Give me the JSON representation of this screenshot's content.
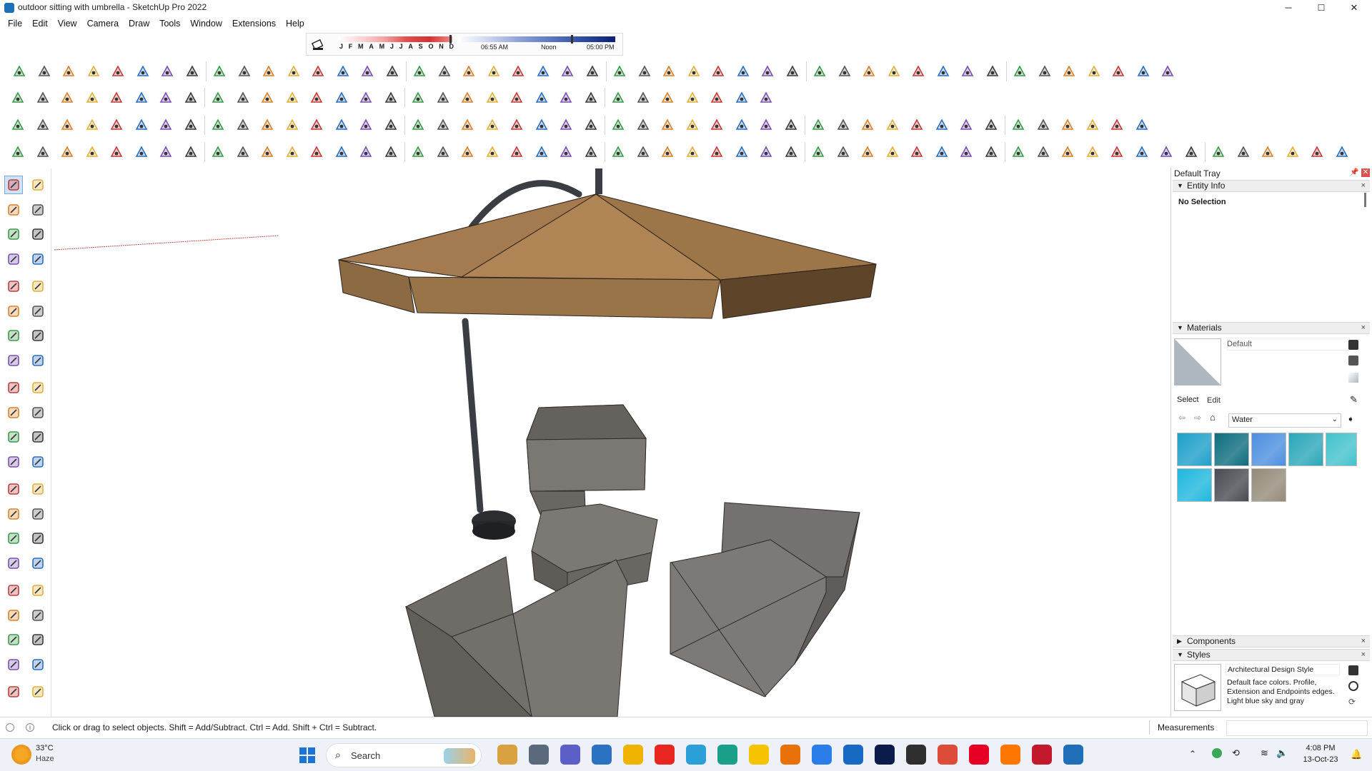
{
  "window": {
    "title": "outdoor sitting with umbrella - SketchUp Pro 2022",
    "controls": {
      "minimize": "─",
      "maximize": "☐",
      "close": "✕"
    }
  },
  "menubar": {
    "items": [
      "File",
      "Edit",
      "View",
      "Camera",
      "Draw",
      "Tools",
      "Window",
      "Extensions",
      "Help"
    ]
  },
  "shadows": {
    "months": [
      "J",
      "F",
      "M",
      "A",
      "M",
      "J",
      "J",
      "A",
      "S",
      "O",
      "N",
      "D"
    ],
    "time_start": "06:55 AM",
    "time_mid": "Noon",
    "time_end": "05:00 PM"
  },
  "toolbars": {
    "row1_icons": [
      "curve-tool-icon",
      "bezier-icon",
      "spline-icon",
      "tangent-icon",
      "polygon-icon",
      "arc-icon",
      "extrude-icon",
      "pipe-icon",
      "loft-icon",
      "sweep-icon",
      "offset-icon",
      "fillet-icon",
      "chamfer-icon",
      "weld-icon",
      "divide-icon",
      "stair-icon",
      "rail-icon",
      "wall-icon",
      "roof-icon",
      "truss-icon",
      "frame-icon",
      "joist-icon",
      "rafter-icon",
      "beam-icon",
      "column-icon",
      "slab-icon",
      "door-icon",
      "window-icon",
      "cabinet-icon",
      "fence-icon",
      "deck-icon",
      "shingle-icon",
      "siding-icon",
      "brick-icon",
      "tile-icon",
      "panel-icon",
      "grid-icon",
      "mesh-icon",
      "loop-icon",
      "ribbon-icon",
      "bridge-icon",
      "knot-icon",
      "sphere-icon",
      "house-icon",
      "house-outline-icon",
      "shed-icon",
      "garage-icon"
    ],
    "row2_icons": [
      "zoom-extents-icon",
      "select-icon",
      "eraser-icon",
      "pencil-icon",
      "arc-draw-icon",
      "rectangle-icon",
      "push-pull-icon",
      "follow-me-icon",
      "move-icon",
      "rotate-icon",
      "scale-icon",
      "tape-icon",
      "text-icon",
      "paint-icon",
      "orbit-icon",
      "pan-icon",
      "zoom-icon",
      "zoom-window-icon",
      "warehouse-icon",
      "extension-icon",
      "layers-icon",
      "outliner-icon",
      "styles-icon",
      "sandbox-icon",
      "import-icon",
      "export-red-icon",
      "export-blue-icon",
      "export-green-icon",
      "export-orange-icon",
      "export-pink-icon",
      "plugin-icon"
    ],
    "row3_icons": [
      "camera-icon",
      "box-icon",
      "iso-icon",
      "front-icon",
      "back-icon",
      "left-icon",
      "right-icon",
      "top-icon",
      "bottom-icon",
      "section-icon",
      "xray-icon",
      "wire-icon",
      "hidden-icon",
      "shaded-icon",
      "texture-icon",
      "mono-icon",
      "shadow-icon",
      "fog-icon",
      "edge-icon",
      "profile-icon",
      "ground-icon",
      "sky-icon",
      "scene-icon",
      "animation-icon",
      "walk-icon",
      "look-icon",
      "position-icon",
      "camera2-icon",
      "sun-icon",
      "grid2-icon",
      "axis-icon",
      "layout-icon",
      "solid-icon",
      "intersect-icon",
      "union-icon",
      "subtract-icon",
      "trim-icon",
      "split-icon",
      "shell-icon",
      "component-icon",
      "group-icon",
      "explode-icon",
      "lock-icon",
      "unlock-icon",
      "hide-icon",
      "unhide-icon"
    ],
    "row4_icons": [
      "smooth-icon",
      "sun-shade-icon",
      "circle-icon",
      "angle-icon",
      "flag-icon",
      "star-icon",
      "dome-icon",
      "ball-icon",
      "copy-icon",
      "paste-icon",
      "cut-icon",
      "duplicate-icon",
      "array-icon",
      "mirror-icon",
      "align-icon",
      "hand-icon",
      "plane-icon",
      "diamond-icon",
      "yellow-diamond-icon",
      "green-diamond-icon",
      "red-diamond-icon",
      "flat-icon",
      "turn-icon",
      "red-block-icon",
      "stack-icon",
      "page-icon",
      "brown-box-icon",
      "link-icon",
      "corner-icon",
      "nodes-icon",
      "plus-red-icon",
      "plus-green-icon",
      "cross-blue-icon",
      "cone-icon",
      "cone2-icon",
      "cone3-icon",
      "lasso-icon",
      "lasso2-icon",
      "rope-icon",
      "arrows-icon",
      "cup-icon",
      "magnet-icon",
      "green-tree-icon",
      "blocks-icon",
      "blocks2-icon",
      "blocks3-icon",
      "red-tile-icon",
      "build-icon",
      "frame2-icon",
      "orange-grid-icon",
      "orange-grid2-icon",
      "orange-grid3-icon",
      "red-x-icon",
      "curve2-icon",
      "grid3-icon"
    ]
  },
  "tray": {
    "title": "Default Tray",
    "entity_info": {
      "heading": "Entity Info",
      "selection": "No Selection"
    },
    "materials": {
      "heading": "Materials",
      "current": "Default",
      "tab_select": "Select",
      "tab_edit": "Edit",
      "library": "Water",
      "swatch_colors": [
        "#1d9fc9",
        "#0d6d7e",
        "#4c8fe0",
        "#2aa7b9",
        "#43c2cc",
        "#1fb7dd",
        "#4a4b52",
        "#948a78"
      ]
    },
    "components": {
      "heading": "Components"
    },
    "styles": {
      "heading": "Styles",
      "style_name": "Architectural Design Style",
      "style_desc": "Default face colors. Profile, Extension and Endpoints edges. Light blue sky and gray"
    }
  },
  "statusbar": {
    "hint": "Click or drag to select objects. Shift = Add/Subtract. Ctrl = Add. Shift + Ctrl = Subtract.",
    "measurements_label": "Measurements"
  },
  "taskbar": {
    "weather_temp": "33°C",
    "weather_desc": "Haze",
    "search_placeholder": "Search",
    "time": "4:08 PM",
    "date": "13-Oct-23",
    "app_colors": [
      "#d9a13f",
      "#5a6a7c",
      "#5b5fc7",
      "#2b73c2",
      "#f0b400",
      "#e8251f",
      "#2a9fd8",
      "#1aa08a",
      "#f5c300",
      "#e8710a",
      "#2b7de9",
      "#1769c3",
      "#0b1b4a",
      "#2f2f2f",
      "#dd4b39",
      "#e60023",
      "#ff7700",
      "#c21a2c",
      "#1e6fb8"
    ]
  }
}
